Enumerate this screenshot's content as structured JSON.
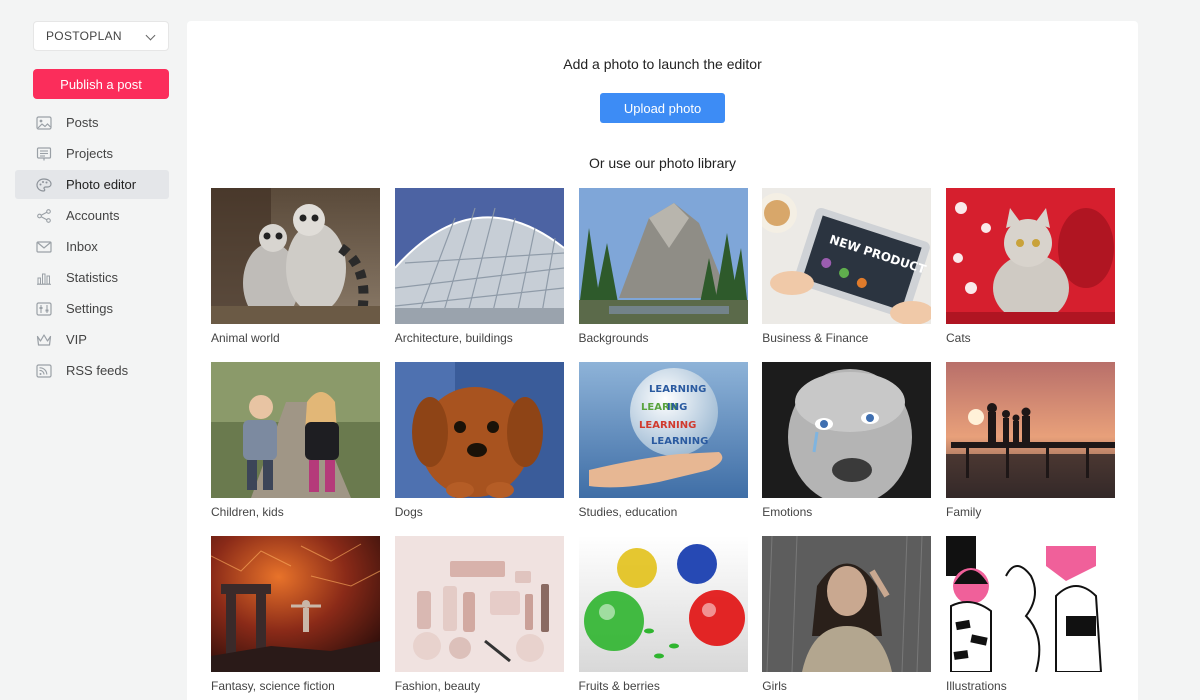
{
  "sidebar": {
    "workspace": "POSTOPLAN",
    "publish_label": "Publish a post",
    "items": [
      {
        "label": "Posts",
        "icon": "image-icon",
        "active": false
      },
      {
        "label": "Projects",
        "icon": "projects-icon",
        "active": false
      },
      {
        "label": "Photo editor",
        "icon": "palette-icon",
        "active": true
      },
      {
        "label": "Accounts",
        "icon": "share-icon",
        "active": false
      },
      {
        "label": "Inbox",
        "icon": "mail-icon",
        "active": false
      },
      {
        "label": "Statistics",
        "icon": "bar-chart-icon",
        "active": false
      },
      {
        "label": "Settings",
        "icon": "sliders-icon",
        "active": false
      },
      {
        "label": "VIP",
        "icon": "crown-icon",
        "active": false
      },
      {
        "label": "RSS feeds",
        "icon": "rss-icon",
        "active": false
      }
    ]
  },
  "main": {
    "headline": "Add a photo to launch the editor",
    "upload_label": "Upload photo",
    "library_title": "Or use our photo library",
    "categories": [
      {
        "label": "Animal world"
      },
      {
        "label": "Architecture, buildings"
      },
      {
        "label": "Backgrounds"
      },
      {
        "label": "Business & Finance"
      },
      {
        "label": "Cats"
      },
      {
        "label": "Children, kids"
      },
      {
        "label": "Dogs"
      },
      {
        "label": "Studies, education"
      },
      {
        "label": "Emotions"
      },
      {
        "label": "Family"
      },
      {
        "label": "Fantasy, science fiction"
      },
      {
        "label": "Fashion, beauty"
      },
      {
        "label": "Fruits & berries"
      },
      {
        "label": "Girls"
      },
      {
        "label": "Illustrations"
      }
    ]
  },
  "colors": {
    "publish": "#fb2d5b",
    "upload": "#3d8cf5",
    "background": "#f3f4f4",
    "active_nav": "#e4e6e9"
  }
}
